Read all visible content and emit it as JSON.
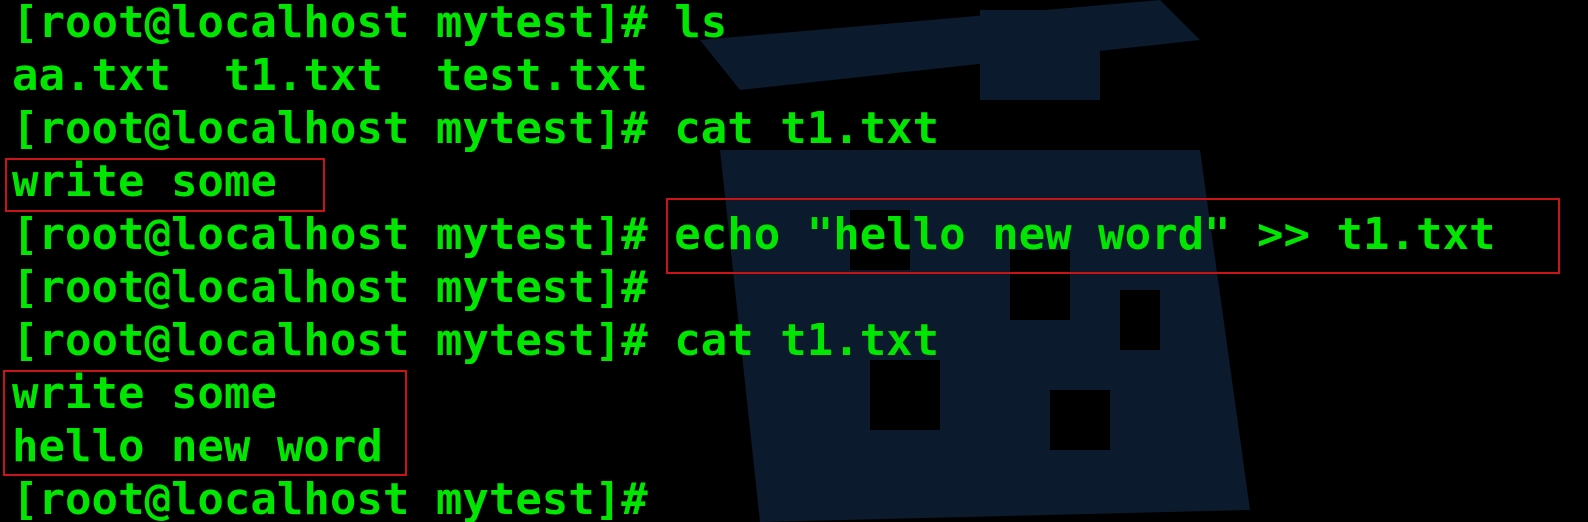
{
  "terminal": {
    "lines": [
      "[root@localhost mytest]# ls",
      "aa.txt  t1.txt  test.txt",
      "[root@localhost mytest]# cat t1.txt",
      "write some",
      "[root@localhost mytest]# echo \"hello new word\" >> t1.txt",
      "[root@localhost mytest]#",
      "[root@localhost mytest]# cat t1.txt",
      "write some",
      "hello new word",
      "[root@localhost mytest]#"
    ]
  },
  "colors": {
    "background": "#000000",
    "text": "#00e600",
    "highlight_border": "#c81414",
    "watermark": "#0b1a2c"
  },
  "icons": {
    "watermark": "watermark-logo"
  }
}
